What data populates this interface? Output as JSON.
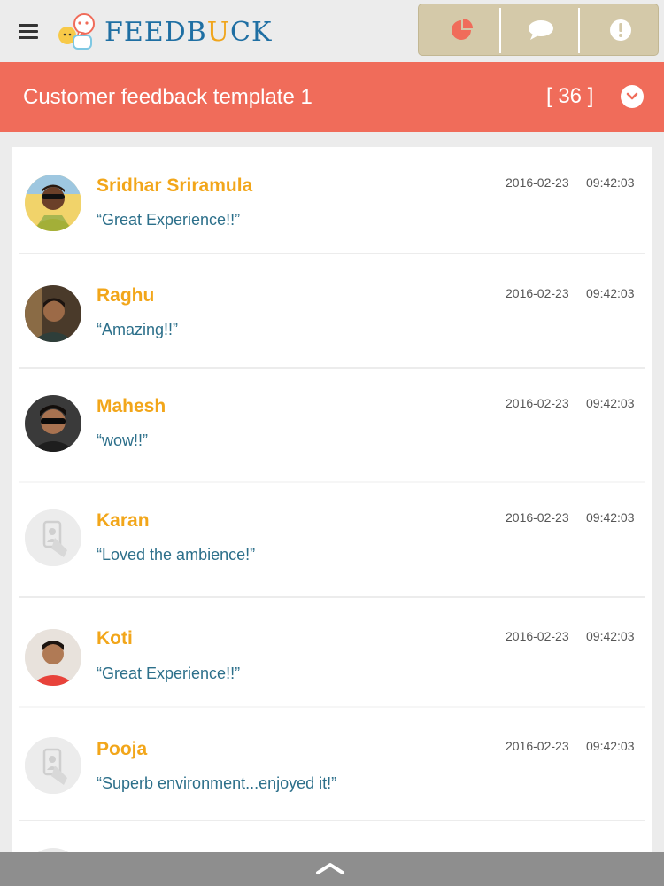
{
  "app": {
    "logo": {
      "part1": "FEEDB",
      "part2": "U",
      "part3": "CK"
    }
  },
  "header": {
    "actions": [
      {
        "icon": "pie-chart-icon"
      },
      {
        "icon": "chat-bubble-icon"
      },
      {
        "icon": "alert-icon"
      }
    ]
  },
  "titlebar": {
    "title": "Customer feedback template 1",
    "count": "[ 36 ]"
  },
  "feedback": [
    {
      "name": "Sridhar Sriramula",
      "message": "“Great Experience!!”",
      "date": "2016-02-23",
      "time": "09:42:03",
      "avatar": "photo"
    },
    {
      "name": "Raghu",
      "message": "“Amazing!!”",
      "date": "2016-02-23",
      "time": "09:42:03",
      "avatar": "photo"
    },
    {
      "name": "Mahesh",
      "message": "“wow!!”",
      "date": "2016-02-23",
      "time": "09:42:03",
      "avatar": "photo"
    },
    {
      "name": "Karan",
      "message": "“Loved the ambience!”",
      "date": "2016-02-23",
      "time": "09:42:03",
      "avatar": "placeholder"
    },
    {
      "name": "Koti",
      "message": "“Great Experience!!”",
      "date": "2016-02-23",
      "time": "09:42:03",
      "avatar": "photo"
    },
    {
      "name": "Pooja",
      "message": "“Superb environment...enjoyed it!”",
      "date": "2016-02-23",
      "time": "09:42:03",
      "avatar": "placeholder"
    }
  ],
  "colors": {
    "accent": "#f06c5a",
    "name": "#f2a61a",
    "message": "#2c6f8a",
    "logo_blue": "#1f6fa3",
    "action_bar": "#d4c9a9"
  }
}
